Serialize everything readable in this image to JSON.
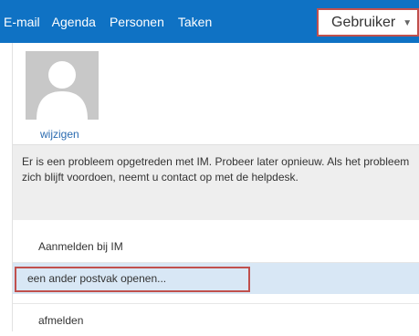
{
  "nav": {
    "items": [
      {
        "label": "E-mail"
      },
      {
        "label": "Agenda"
      },
      {
        "label": "Personen"
      },
      {
        "label": "Taken"
      }
    ]
  },
  "user_menu": {
    "label": "Gebruiker",
    "caret_icon": "chevron-down-icon"
  },
  "profile": {
    "change_link": "wijzigen"
  },
  "error_message": "Er is een probleem opgetreden met IM. Probeer later opnieuw. Als het probleem zich blijft voordoen, neemt u contact op met de helpdesk.",
  "menu": {
    "sign_in_im": "Aanmelden bij IM",
    "open_other_mailbox": "een ander postvak openen...",
    "sign_out": "afmelden"
  },
  "colors": {
    "top_bar": "#0f72c4",
    "highlight_border": "#c0504d",
    "selected_item_bg": "#d8e7f5",
    "link": "#2b6bb0"
  }
}
